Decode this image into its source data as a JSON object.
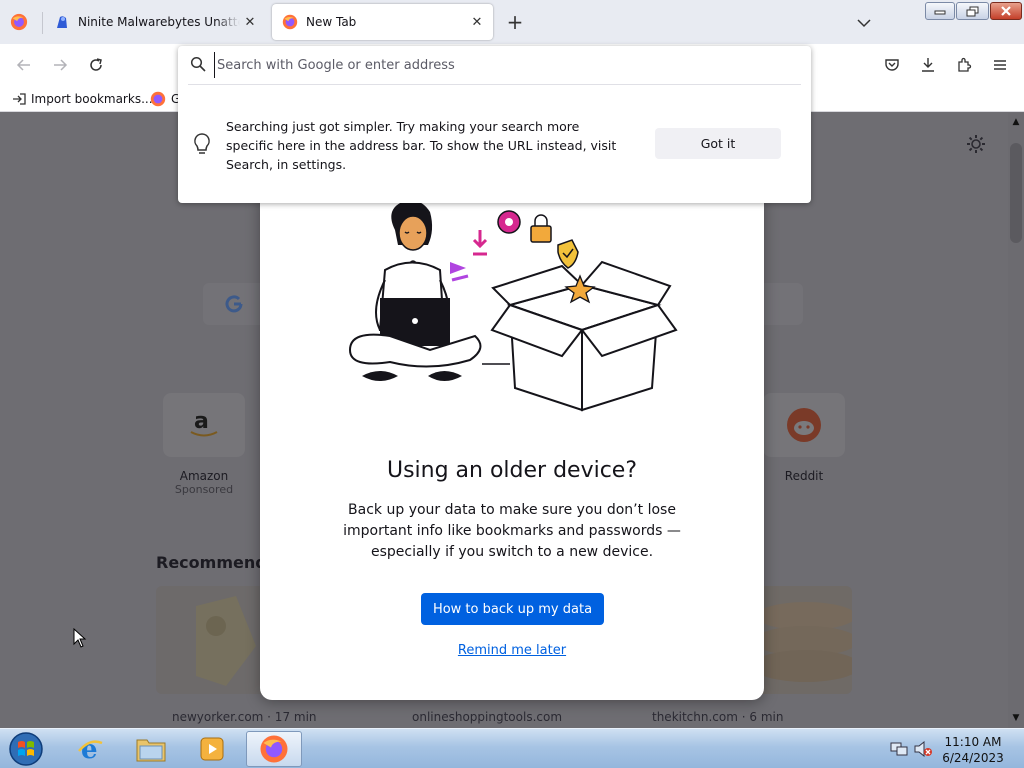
{
  "browser": {
    "tabs": [
      {
        "title": "Ninite Malwarebytes Unattended",
        "active": false
      },
      {
        "title": "New Tab",
        "active": true
      }
    ],
    "address_bar": {
      "value": "",
      "placeholder": "Search with Google or enter address"
    },
    "bookmarks": [
      {
        "label": "Import bookmarks..."
      },
      {
        "label": "G"
      }
    ]
  },
  "address_tip": {
    "text": "Searching just got simpler. Try making your search more specific here in the address bar. To show the URL instead, visit Search, in settings.",
    "button": "Got it"
  },
  "newtab": {
    "shortcuts": [
      {
        "name": "Amazon",
        "sponsored": "Sponsored"
      },
      {
        "name": "Reddit",
        "sponsored": ""
      }
    ],
    "recommended_title": "Recommende",
    "stories": [
      {
        "source": "newyorker.com · 17 min"
      },
      {
        "source": "onlineshoppingtools.com"
      },
      {
        "source": "thekitchn.com · 6 min"
      }
    ]
  },
  "modal": {
    "title": "Using an older device?",
    "body": "Back up your data to make sure you don’t lose important info like bookmarks and passwords — especially if you switch to a new device.",
    "primary_button": "How to back up my data",
    "secondary_link": "Remind me later"
  },
  "taskbar": {
    "time": "11:10 AM",
    "date": "6/24/2023"
  },
  "colors": {
    "accent": "#0061e0",
    "dim_overlay": "#6e6d72",
    "taskbar": "#a7c4e4"
  }
}
